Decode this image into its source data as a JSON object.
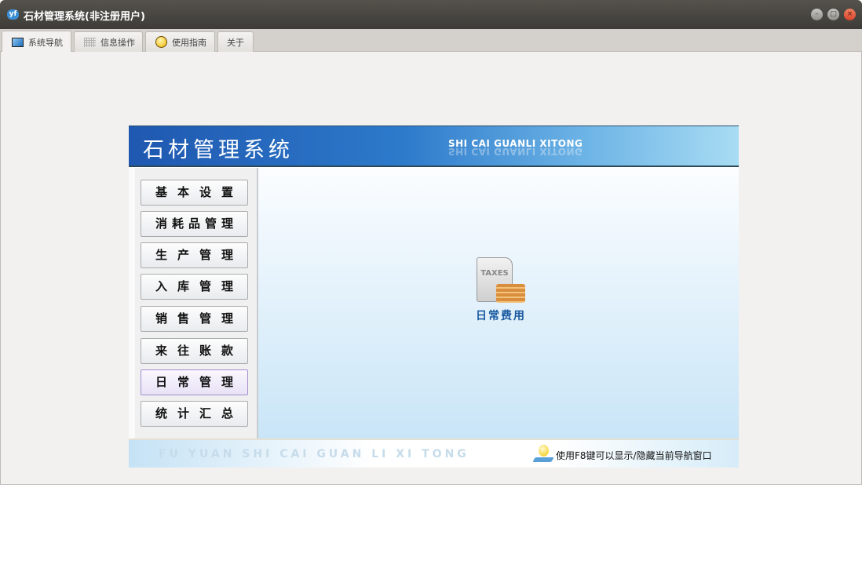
{
  "window": {
    "title": "石材管理系统(非注册用户)",
    "app_icon": "yf"
  },
  "tabs": [
    {
      "label": "系统导航",
      "icon": "monitor-icon"
    },
    {
      "label": "信息操作",
      "icon": "grid-icon"
    },
    {
      "label": "使用指南",
      "icon": "help-icon"
    },
    {
      "label": "关于"
    }
  ],
  "header": {
    "title": "石材管理系统",
    "subtitle": "SHI CAI GUANLI XITONG"
  },
  "nav": [
    "基本设置",
    "消耗品管理",
    "生产管理",
    "入库管理",
    "销售管理",
    "来往账款",
    "日常管理",
    "统计汇总"
  ],
  "selected_nav": "日常管理",
  "main": {
    "items": [
      {
        "label": "日常费用",
        "icon_text": "TAXES"
      }
    ]
  },
  "footer": {
    "brand": "FU YUAN SHI CAI GUAN LI XI TONG",
    "tip": "使用F8键可以显示/隐藏当前导航窗口"
  }
}
